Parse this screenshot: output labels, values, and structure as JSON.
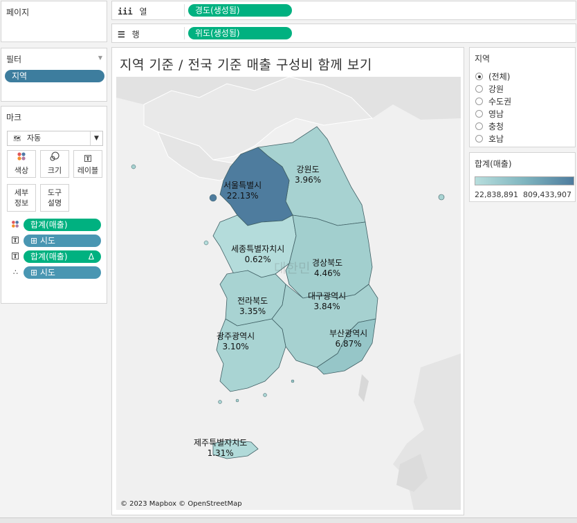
{
  "pages_card": {
    "title": "페이지"
  },
  "columns_shelf": {
    "label": "열",
    "icon": "iii",
    "pill": "경도(생성됨)"
  },
  "rows_shelf": {
    "label": "행",
    "icon": "☰",
    "pill": "위도(생성됨)"
  },
  "filters_card": {
    "title": "필터",
    "pill": "지역"
  },
  "marks_card": {
    "title": "마크",
    "mark_type": "자동",
    "buttons": {
      "color": "색상",
      "size": "크기",
      "label": "레이블",
      "detail_line1": "세부",
      "detail_line2": "정보",
      "tooltip_line1": "도구",
      "tooltip_line2": "설명"
    },
    "fields": [
      {
        "label": "합계(매출)",
        "encoding": "color"
      },
      {
        "label": "⊞ 시도",
        "encoding": "label"
      },
      {
        "label": "합계(매출)",
        "encoding": "label",
        "badge": "Δ"
      },
      {
        "label": "⊞ 시도",
        "encoding": "detail"
      }
    ]
  },
  "viz": {
    "title": "지역 기준 / 전국 기준 매출 구성비 함께 보기",
    "watermark": "대한민",
    "credit": "© 2023 Mapbox © OpenStreetMap",
    "regions": [
      {
        "name": "서울특별시",
        "pct": "22.13%",
        "color": "#4e7c9e"
      },
      {
        "name": "강원도",
        "pct": "3.96%",
        "color": "#a7d2d1"
      },
      {
        "name": "세종특별자치시",
        "pct": "0.62%",
        "color": "#b4dcdb"
      },
      {
        "name": "경상북도",
        "pct": "4.46%",
        "color": "#a2cfce"
      },
      {
        "name": "전라북도",
        "pct": "3.35%",
        "color": "#a8d3d2"
      },
      {
        "name": "대구광역시",
        "pct": "3.84%",
        "color": "#a6d1d0"
      },
      {
        "name": "광주광역시",
        "pct": "3.10%",
        "color": "#a9d4d3"
      },
      {
        "name": "부산광역시",
        "pct": "6.87%",
        "color": "#96c6c8"
      },
      {
        "name": "제주특별자치도",
        "pct": "1.31%",
        "color": "#b1dad9"
      }
    ]
  },
  "region_filter": {
    "title": "지역",
    "options": [
      "(전체)",
      "강원",
      "수도권",
      "영남",
      "충청",
      "호남"
    ],
    "selected": "(전체)"
  },
  "legend": {
    "title": "합계(매출)",
    "min": "22,838,891",
    "max": "809,433,907",
    "color_low": "#b8dedd",
    "color_high": "#4e7c9e"
  }
}
